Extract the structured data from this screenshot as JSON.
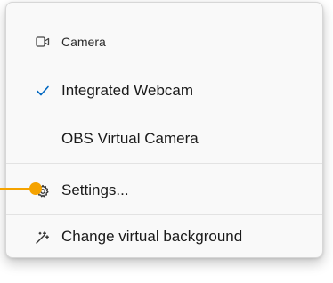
{
  "menu": {
    "section_header": {
      "label": "Camera",
      "icon": "video-camera-icon"
    },
    "items": [
      {
        "label": "Integrated Webcam",
        "selected": true,
        "icon": "checkmark-icon"
      },
      {
        "label": "OBS Virtual Camera",
        "selected": false
      }
    ],
    "settings": {
      "label": "Settings...",
      "icon": "gear-icon"
    },
    "virtual_background": {
      "label": "Change virtual background",
      "icon": "magic-wand-icon"
    }
  },
  "colors": {
    "accent": "#0067c0",
    "callout": "#f5a300",
    "menu_bg": "#f9f9f9",
    "divider": "#e3e3e3"
  }
}
